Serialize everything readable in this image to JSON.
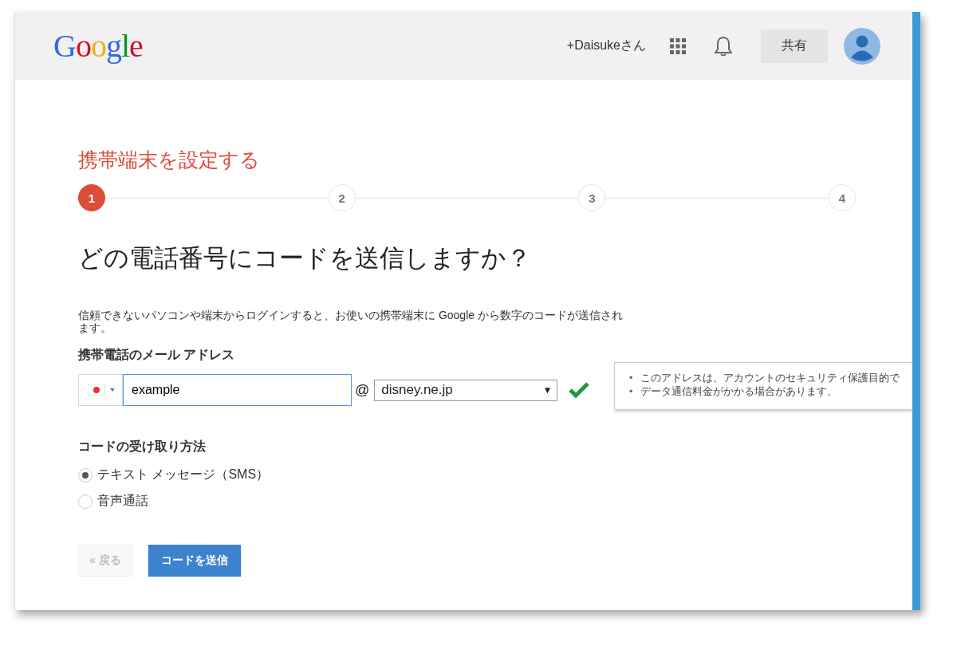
{
  "header": {
    "logo": "Google",
    "user": "+Daisukeさん",
    "share_button": "共有"
  },
  "title": "携帯端末を設定する",
  "steps": [
    {
      "label": "1",
      "selected": true
    },
    {
      "label": "2",
      "selected": false
    },
    {
      "label": "3",
      "selected": false
    },
    {
      "label": "4",
      "selected": false
    }
  ],
  "question": "どの電話番号にコードを送信しますか？",
  "description": "信頼できないパソコンや端末からログインすると、お使いの携帯端末に Google から数字のコードが送信されます。",
  "email_label": "携帯電話のメール アドレス",
  "email": {
    "value": "example",
    "at": "@",
    "domain": "disney.ne.jp",
    "domain_arrow": "▼",
    "valid": true
  },
  "tooltip": [
    {
      "bullet": "•",
      "text": "このアドレスは、アカウントのセキュリティ保護目的で"
    },
    {
      "bullet": "•",
      "text": "データ通信料金がかかる場合があります。"
    }
  ],
  "method_label": "コードの受け取り方法",
  "methods": [
    {
      "label": "テキスト メッセージ（SMS）",
      "selected": true
    },
    {
      "label": "音声通話",
      "selected": false
    }
  ],
  "buttons": {
    "back": {
      "label": "« 戻る",
      "disabled": true
    },
    "send": {
      "label": "コードを送信"
    }
  }
}
